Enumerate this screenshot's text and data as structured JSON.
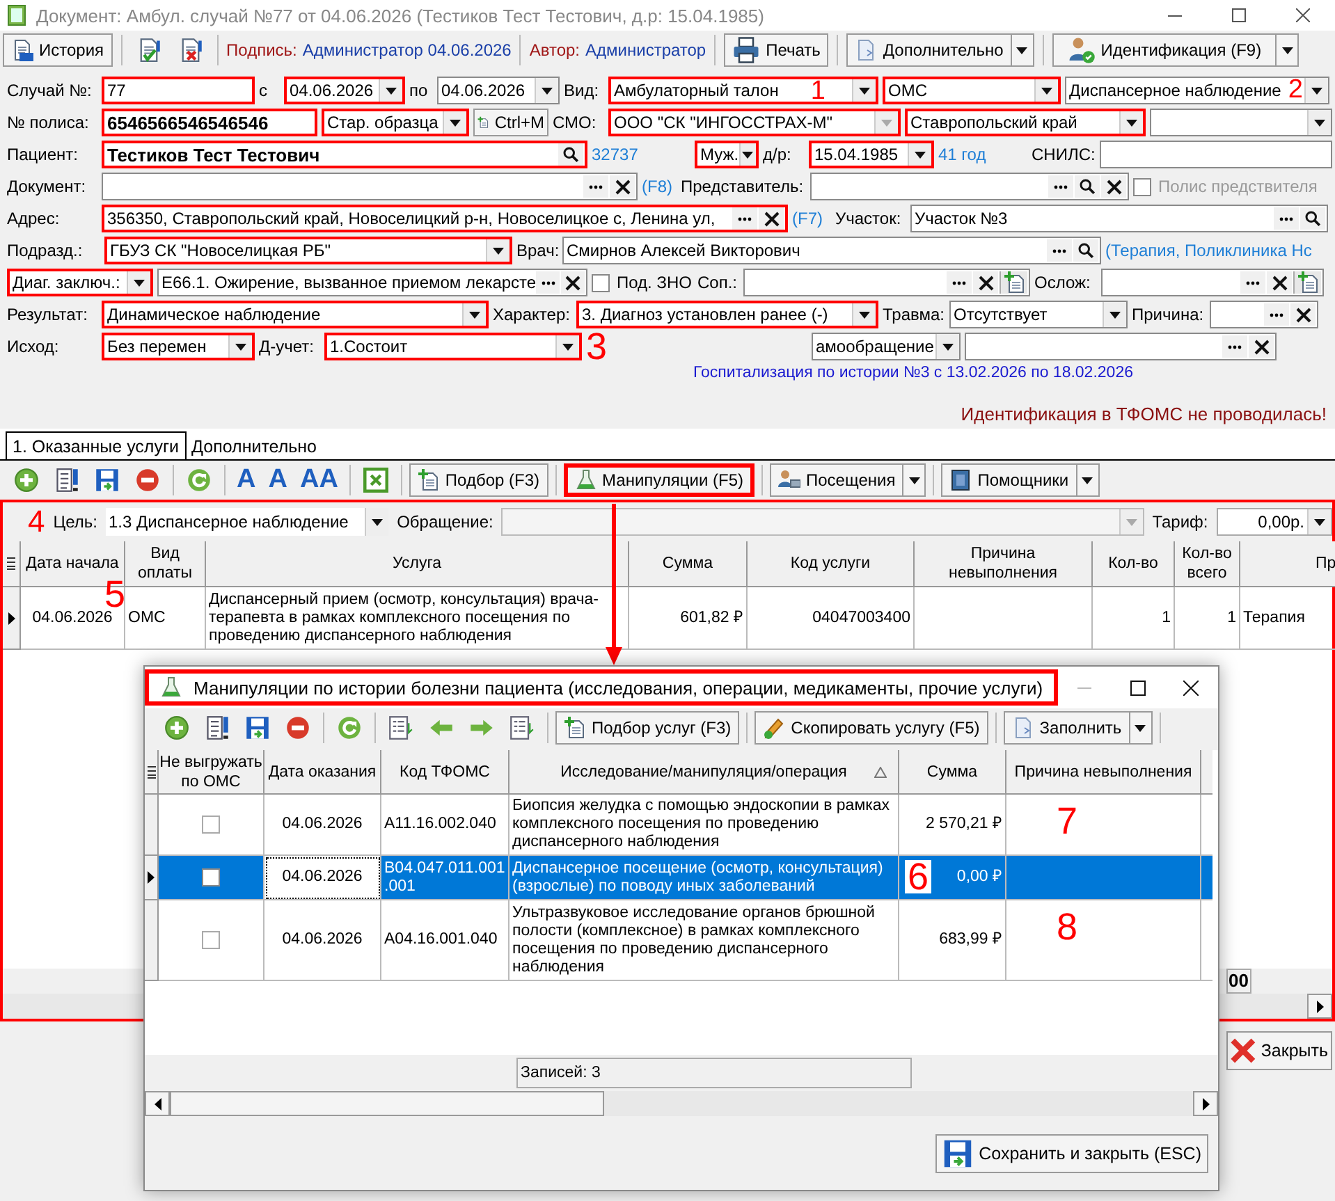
{
  "window": {
    "title": "Документ: Амбул. случай №77 от 04.06.2026 (Тестиков Тест Тестович, д.р: 15.04.1985)"
  },
  "toolbar": {
    "history_button": "История",
    "signature_label": "Подпись:",
    "signature_value": "Администратор 04.06.2026",
    "author_label": "Автор:",
    "author_value": "Администратор",
    "print_button": "Печать",
    "more_button": "Дополнительно",
    "identify_button": "Идентификация (F9)"
  },
  "form": {
    "rows": [
      {
        "items": [
          {
            "kind": "label",
            "text": "Случай №:"
          },
          {
            "kind": "field",
            "value": "77",
            "highlighted": true
          },
          {
            "kind": "label",
            "text": "с"
          },
          {
            "kind": "select",
            "value": "04.06.2026",
            "highlighted": true
          },
          {
            "kind": "label",
            "text": "по"
          },
          {
            "kind": "select",
            "value": "04.06.2026",
            "highlighted": false
          },
          {
            "kind": "label",
            "text": "Вид:"
          },
          {
            "kind": "select",
            "value": "Амбулаторный талон",
            "highlighted": true,
            "marker": "1"
          },
          {
            "kind": "select",
            "value": "ОМС",
            "highlighted": true
          },
          {
            "kind": "select",
            "value": "Диспансерное наблюдение",
            "highlighted": false,
            "marker": "2"
          }
        ]
      },
      {
        "items": [
          {
            "kind": "label",
            "text": "№ полиса:"
          },
          {
            "kind": "field",
            "value": "6546566546546546",
            "bold": true,
            "highlighted": true
          },
          {
            "kind": "select",
            "value": "Стар. образца",
            "highlighted": true
          },
          {
            "kind": "button",
            "label": "Ctrl+M"
          },
          {
            "kind": "label",
            "text": "СМО:"
          },
          {
            "kind": "select",
            "value": "ООО \"СК \"ИНГОССТРАХ-М\"",
            "highlighted": true,
            "disabled": true
          },
          {
            "kind": "select",
            "value": "Ставропольский край",
            "highlighted": true
          },
          {
            "kind": "select",
            "highlighted": false
          }
        ]
      },
      {
        "items": [
          {
            "kind": "label",
            "text": "Пациент:"
          },
          {
            "kind": "field",
            "value": "Тестиков Тест Тестович",
            "bold": true,
            "highlighted": true
          },
          {
            "kind": "link",
            "text": "32737"
          },
          {
            "kind": "select",
            "value": "Муж.",
            "highlighted": true
          },
          {
            "kind": "label",
            "text": "д/р:"
          },
          {
            "kind": "select",
            "value": "15.04.1985",
            "highlighted": true
          },
          {
            "kind": "link",
            "text": "41 год"
          },
          {
            "kind": "label",
            "text": "СНИЛС:"
          },
          {
            "kind": "field",
            "highlighted": false
          }
        ]
      },
      {
        "items": [
          {
            "kind": "label",
            "text": "Документ:"
          },
          {
            "kind": "field",
            "highlighted": false
          },
          {
            "kind": "link",
            "text": "(F8)"
          },
          {
            "kind": "label",
            "text": "Представитель:"
          },
          {
            "kind": "field",
            "highlighted": false
          },
          {
            "kind": "checkbox",
            "label": "Полис предствителя",
            "checked": false,
            "disabled": true
          }
        ]
      },
      {
        "items": [
          {
            "kind": "label",
            "text": "Адрес:"
          },
          {
            "kind": "field",
            "value": "356350, Ставропольский край, Новоселицкий р-н, Новоселицкое с, Ленина ул,",
            "highlighted": true
          },
          {
            "kind": "link",
            "text": "(F7)"
          },
          {
            "kind": "label",
            "text": "Участок:"
          },
          {
            "kind": "field",
            "value": "Участок №3",
            "highlighted": false
          }
        ]
      },
      {
        "items": [
          {
            "kind": "label",
            "text": "Подразд.:"
          },
          {
            "kind": "select",
            "value": "ГБУЗ СК \"Новоселицкая РБ\"",
            "highlighted": true
          },
          {
            "kind": "label",
            "text": "Врач:"
          },
          {
            "kind": "field",
            "value": "Смирнов Алексей Викторович",
            "highlighted": false
          },
          {
            "kind": "link",
            "text": "(Терапия, Поликлиника Нс"
          }
        ]
      },
      {
        "items": [
          {
            "kind": "select",
            "value": "Диаг. заключ.:",
            "highlighted": true
          },
          {
            "kind": "field",
            "value": "E66.1. Ожирение, вызванное приемом лекарсте",
            "highlighted": false
          },
          {
            "kind": "checkbox",
            "label": "Под. ЗНО",
            "checked": false,
            "disabled": false
          },
          {
            "kind": "label",
            "text": "Соп.:"
          },
          {
            "kind": "field",
            "highlighted": false
          },
          {
            "kind": "label",
            "text": "Ослож:"
          },
          {
            "kind": "field",
            "highlighted": false
          }
        ]
      },
      {
        "items": [
          {
            "kind": "label",
            "text": "Результат:"
          },
          {
            "kind": "select",
            "value": "Динамическое наблюдение",
            "highlighted": true
          },
          {
            "kind": "label",
            "text": "Характер:"
          },
          {
            "kind": "select",
            "value": "3. Диагноз установлен ранее (-)",
            "highlighted": true
          },
          {
            "kind": "label",
            "text": "Травма:"
          },
          {
            "kind": "select",
            "value": "Отсутствует",
            "highlighted": false
          },
          {
            "kind": "label",
            "text": "Причина:"
          },
          {
            "kind": "field",
            "highlighted": false
          }
        ]
      },
      {
        "items": [
          {
            "kind": "label",
            "text": "Исход:"
          },
          {
            "kind": "select",
            "value": "Без перемен",
            "highlighted": true
          },
          {
            "kind": "label",
            "text": "Д-учет:"
          },
          {
            "kind": "select",
            "value": "1.Состоит",
            "highlighted": true
          },
          {
            "kind": "marker",
            "text": "3"
          },
          {
            "kind": "select",
            "value": "амообращение",
            "highlighted": false
          },
          {
            "kind": "field",
            "highlighted": false
          }
        ]
      }
    ]
  },
  "hospitalization_note": "Госпитализация по истории №3 с 13.02.2026 по 18.02.2026",
  "identification_warning": "Идентификация в ТФОМС не проводилась!",
  "tabs": [
    {
      "label": "1. Оказанные услуги",
      "selected": true
    },
    {
      "label": "Дополнительно",
      "selected": false
    }
  ],
  "services": {
    "highlighted": true,
    "marker": "4",
    "font_buttons": [
      "A",
      "A",
      "AA"
    ],
    "toolbar_buttons": [
      {
        "label": "Подбор (F3)",
        "highlighted": false,
        "dropdown": false
      },
      {
        "label": "Манипуляции (F5)",
        "highlighted": true,
        "dropdown": false
      },
      {
        "label": "Посещения",
        "highlighted": false,
        "dropdown": true
      },
      {
        "label": "Помощники",
        "highlighted": false,
        "dropdown": true
      }
    ],
    "goal_label": "Цель:",
    "goal_value": "1.3 Диспансерное наблюдение",
    "appeal_label": "Обращение:",
    "tariff_label": "Тариф:",
    "tariff_value": "0,00р.",
    "table": {
      "columns": [
        "Дата начала",
        "Вид оплаты",
        "Услуга",
        "Сумма",
        "Код услуги",
        "Причина невыполнения",
        "Кол-во",
        "Кол-во всего",
        "Пр"
      ],
      "rows": [
        {
          "current": true,
          "marker": "5",
          "cells": [
            "04.06.2026",
            "ОМС",
            "Диспансерный прием (осмотр, консультация) врача-терапевта в рамках комплексного посещения по проведению диспансерного наблюдения",
            "601,82 ₽",
            "04047003400",
            "",
            "1",
            "1",
            "Терапия"
          ]
        }
      ]
    },
    "total_partial": "00"
  },
  "close_button": "Закрыть",
  "dialog": {
    "title": "Манипуляции по истории болезни пациента (исследования, операции, медикаменты, прочие услуги)",
    "title_highlighted": true,
    "toolbar_buttons": [
      {
        "label": "Подбор услуг (F3)",
        "dropdown": false
      },
      {
        "label": "Скопировать услугу (F5)",
        "dropdown": false
      },
      {
        "label": "Заполнить",
        "dropdown": true
      }
    ],
    "columns": [
      {
        "label": "Не выгружать по ОМС",
        "sorted": false
      },
      {
        "label": "Дата оказания",
        "sorted": false
      },
      {
        "label": "Код ТФОМС",
        "sorted": false
      },
      {
        "label": "Исследование/манипуляция/операция",
        "sorted": true
      },
      {
        "label": "Сумма",
        "sorted": false
      },
      {
        "label": "Причина невыполнения",
        "sorted": false
      }
    ],
    "rows": [
      {
        "no_export": false,
        "selected": false,
        "date": "04.06.2026",
        "code": "A11.16.002.040",
        "name": "Биопсия желудка с помощью эндоскопии в рамках комплексного посещения по проведению диспансерного наблюдения",
        "sum": "2 570,21 ₽",
        "reason": "",
        "marker": "7"
      },
      {
        "no_export": false,
        "selected": true,
        "date": "04.06.2026",
        "code": "B04.047.011.001 .001",
        "name": "Диспансерное посещение (осмотр, консультация) (взрослые) по поводу иных заболеваний",
        "sum": "0,00 ₽",
        "reason": "",
        "marker": "6"
      },
      {
        "no_export": false,
        "selected": false,
        "date": "04.06.2026",
        "code": "A04.16.001.040",
        "name": "Ультразвуковое исследование органов брюшной полости (комплексное) в рамках комплексного посещения по проведению диспансерного наблюдения",
        "sum": "683,99 ₽",
        "reason": "",
        "marker": "8"
      }
    ],
    "records": "Записей: 3",
    "save_button": "Сохранить и закрыть (ESC)"
  }
}
